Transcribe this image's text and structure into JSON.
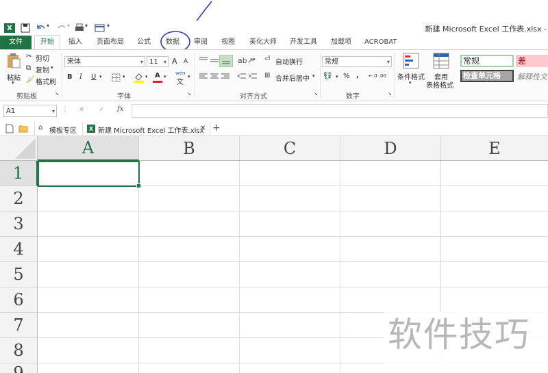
{
  "window": {
    "title": "新建 Microsoft Excel 工作表.xlsx -"
  },
  "tabs": [
    {
      "label": "文件"
    },
    {
      "label": "开始"
    },
    {
      "label": "插入"
    },
    {
      "label": "页面布局"
    },
    {
      "label": "公式"
    },
    {
      "label": "数据"
    },
    {
      "label": "审阅"
    },
    {
      "label": "视图"
    },
    {
      "label": "美化大师"
    },
    {
      "label": "开发工具"
    },
    {
      "label": "加载项"
    },
    {
      "label": "ACROBAT"
    }
  ],
  "clipboard": {
    "paste": "粘贴",
    "cut": "剪切",
    "copy": "复制",
    "format_painter": "格式刷",
    "group": "剪贴板"
  },
  "font": {
    "name": "宋体",
    "size": "11",
    "grow": "A",
    "shrink": "A",
    "bold": "B",
    "italic": "I",
    "underline": "U",
    "color_glyph": "A",
    "wen": "wén",
    "wen_char": "文",
    "group": "字体"
  },
  "alignment": {
    "wrap": "自动换行",
    "merge": "合并后居中",
    "group": "对齐方式"
  },
  "number": {
    "format": "常规",
    "percent": "%",
    "comma": ",",
    "dec_inc": "←.0 .00",
    "dec_dec": ".00 →.0",
    "group": "数字"
  },
  "styles": {
    "conditional": "条件格式",
    "table_format_1": "套用",
    "table_format_2": "表格格式",
    "normal": "常规",
    "bad": "差",
    "check_cell": "检查单元格",
    "explanatory": "解释性文"
  },
  "formula_bar": {
    "name_box": "A1",
    "fx": "fx",
    "cancel": "✕",
    "enter": "✓"
  },
  "workbook_tabs": {
    "template": "模板专区",
    "file": "新建 Microsoft Excel 工作表.xlsx",
    "close": "✕",
    "add": "+"
  },
  "columns": [
    "A",
    "B",
    "C",
    "D",
    "E"
  ],
  "rows": [
    "1",
    "2",
    "3",
    "4",
    "5",
    "6",
    "7",
    "8",
    "9"
  ],
  "watermark": "软件技巧",
  "colors": {
    "excel_green": "#217346",
    "annotation_blue": "#2a3cb0"
  }
}
